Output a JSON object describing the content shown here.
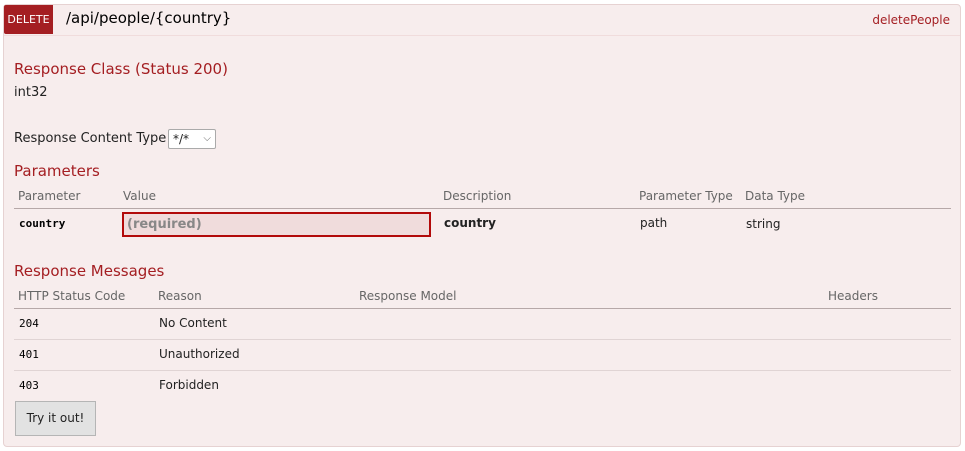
{
  "operation": {
    "method": "DELETE",
    "path": "/api/people/{country}",
    "nickname": "deletePeople"
  },
  "response_class": {
    "title": "Response Class (Status 200)",
    "type": "int32"
  },
  "content_type": {
    "label": "Response Content Type",
    "selected": "*/*"
  },
  "parameters": {
    "title": "Parameters",
    "headers": [
      "Parameter",
      "Value",
      "Description",
      "Parameter Type",
      "Data Type"
    ],
    "rows": [
      {
        "name": "country",
        "placeholder": "(required)",
        "description": "country",
        "param_type": "path",
        "data_type": "string"
      }
    ]
  },
  "response_messages": {
    "title": "Response Messages",
    "headers": [
      "HTTP Status Code",
      "Reason",
      "Response Model",
      "Headers"
    ],
    "rows": [
      {
        "code": "204",
        "reason": "No Content"
      },
      {
        "code": "401",
        "reason": "Unauthorized"
      },
      {
        "code": "403",
        "reason": "Forbidden"
      }
    ]
  },
  "submit_label": "Try it out!",
  "colors": {
    "method_delete": "#a41e22",
    "panel_bg": "#f7eded",
    "heading_text": "#a41e22"
  }
}
